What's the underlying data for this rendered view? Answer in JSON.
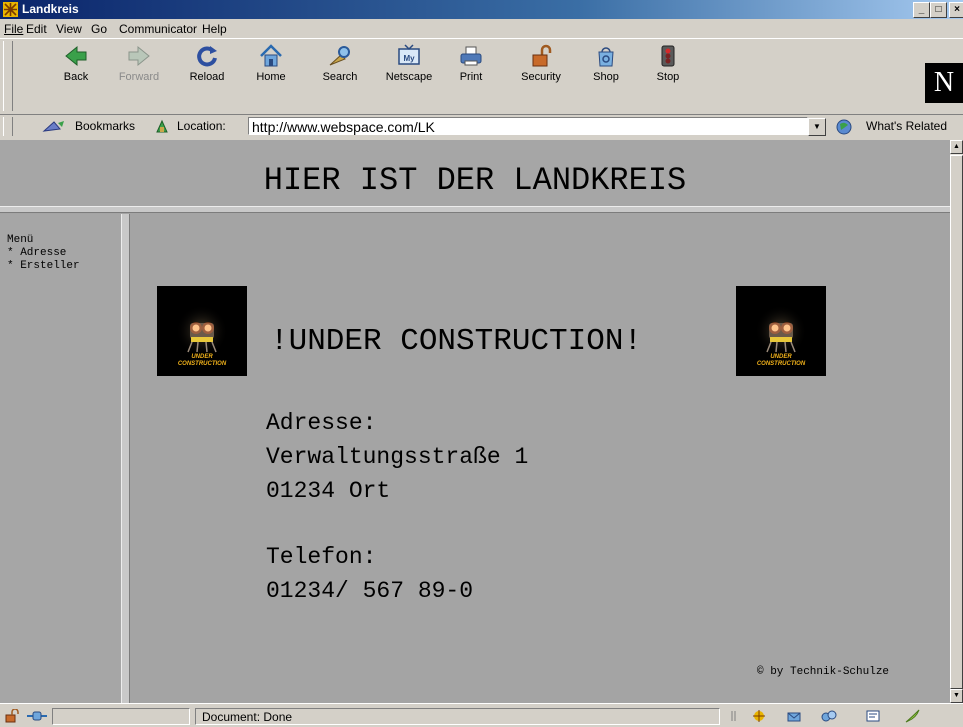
{
  "window": {
    "title": "Landkreis"
  },
  "menu": [
    "File",
    "Edit",
    "View",
    "Go",
    "Communicator",
    "Help"
  ],
  "toolbar": {
    "buttons": [
      {
        "label": "Back",
        "icon": "back-arrow-icon"
      },
      {
        "label": "Forward",
        "icon": "forward-arrow-icon",
        "disabled": true
      },
      {
        "label": "Reload",
        "icon": "reload-icon"
      },
      {
        "label": "Home",
        "icon": "home-icon"
      },
      {
        "label": "Search",
        "icon": "search-icon"
      },
      {
        "label": "Netscape",
        "icon": "netscape-icon"
      },
      {
        "label": "Print",
        "icon": "print-icon"
      },
      {
        "label": "Security",
        "icon": "security-lock-icon"
      },
      {
        "label": "Shop",
        "icon": "shop-icon"
      },
      {
        "label": "Stop",
        "icon": "stop-icon"
      }
    ],
    "logo_letter": "N"
  },
  "location": {
    "bookmarks_label": "Bookmarks",
    "location_label": "Location:",
    "url": "http://www.webspace.com/LK",
    "whats_related": "What's Related"
  },
  "page": {
    "header": "HIER IST DER LANDKREIS",
    "menu_title": "Menü",
    "menu_items": [
      "* Adresse",
      "* Ersteller"
    ],
    "construction_image_text": "UNDER CONSTRUCTION",
    "construction_headline": "!UNDER CONSTRUCTION!",
    "address_label": "Adresse:",
    "street": "Verwaltungsstraße 1",
    "city": "01234 Ort",
    "phone_label": "Telefon:",
    "phone": "01234/ 567 89-0",
    "copyright": "© by Technik-Schulze"
  },
  "status": {
    "text": "Document: Done"
  },
  "colors": {
    "page_background": "#a4a4a4",
    "frame_separator": "#c8c8c8",
    "titlebar": "#0a246a"
  }
}
